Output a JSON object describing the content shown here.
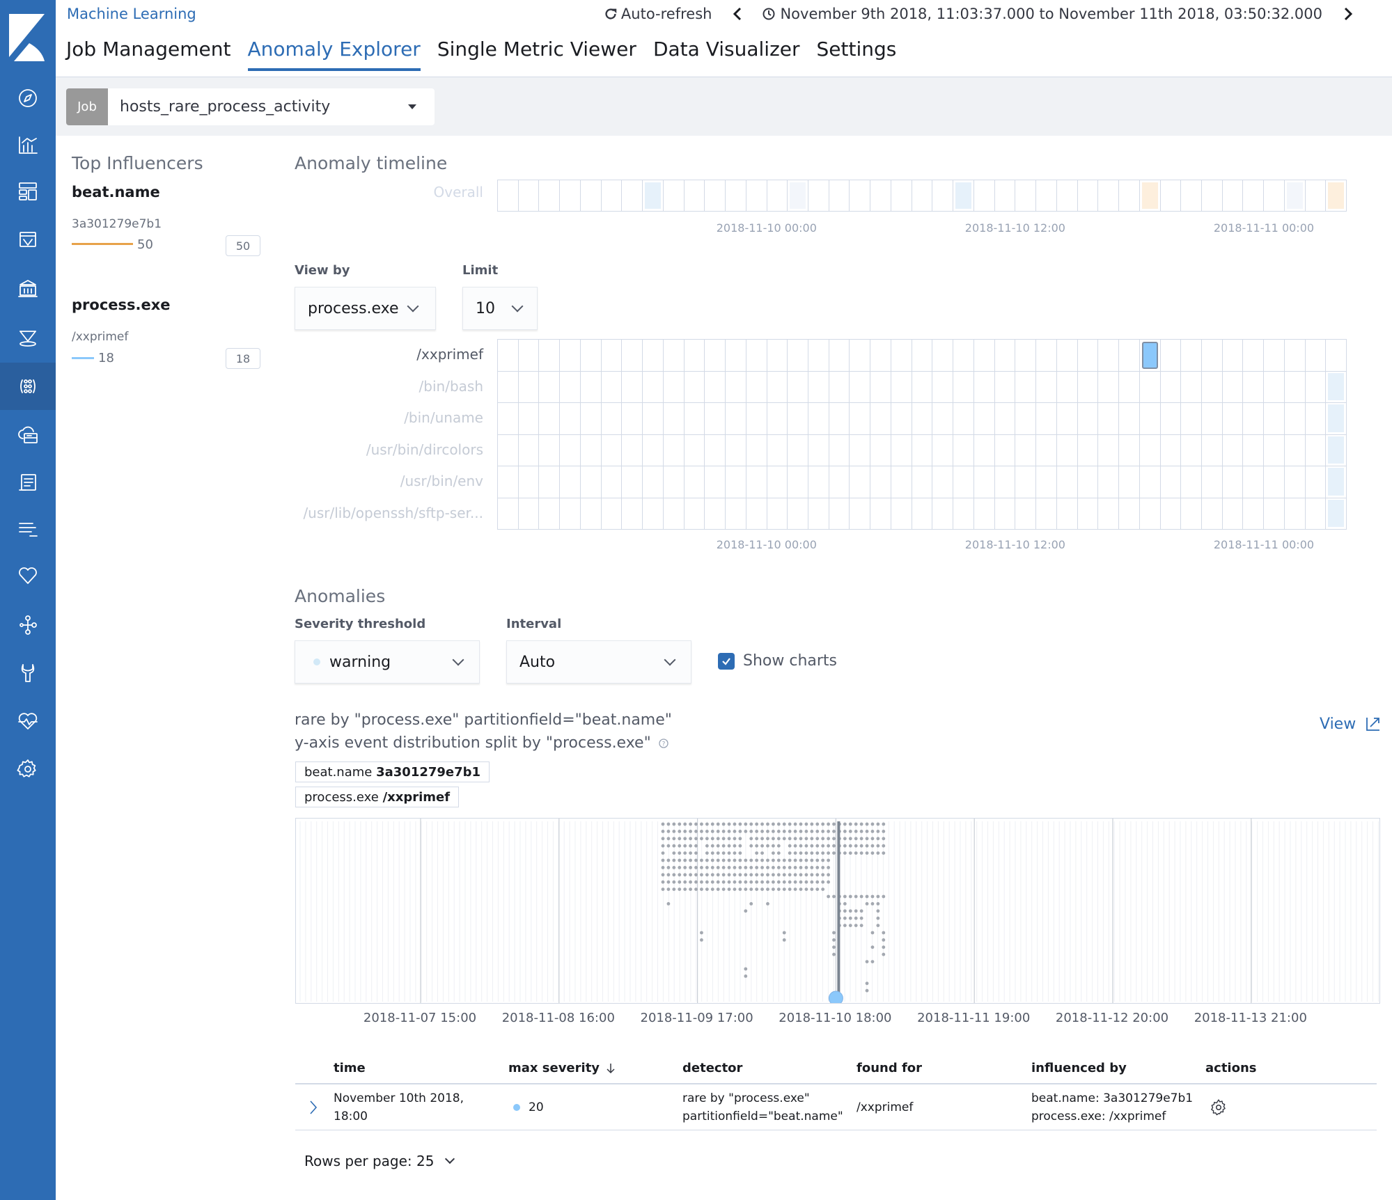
{
  "app": {
    "title": "Machine Learning",
    "auto_refresh_label": "Auto-refresh",
    "time_range": "November 9th 2018, 11:03:37.000 to November 11th 2018, 03:50:32.000"
  },
  "sidebar": {
    "items": [
      {
        "name": "discover",
        "icon": "compass-icon"
      },
      {
        "name": "visualize",
        "icon": "visualize-icon"
      },
      {
        "name": "dashboard",
        "icon": "dashboard-icon"
      },
      {
        "name": "canvas",
        "icon": "canvas-icon"
      },
      {
        "name": "maps",
        "icon": "maps-icon"
      },
      {
        "name": "infrastructure",
        "icon": "infrastructure-icon"
      },
      {
        "name": "machine-learning",
        "icon": "machine-learning-icon",
        "active": true
      },
      {
        "name": "logs",
        "icon": "logs-icon"
      },
      {
        "name": "apm",
        "icon": "apm-icon"
      },
      {
        "name": "uptime",
        "icon": "uptime-icon"
      },
      {
        "name": "siem",
        "icon": "heart-icon"
      },
      {
        "name": "graph",
        "icon": "graph-icon"
      },
      {
        "name": "dev-tools",
        "icon": "wrench-icon"
      },
      {
        "name": "monitoring",
        "icon": "heartbeat-icon"
      },
      {
        "name": "management",
        "icon": "gear-icon"
      }
    ]
  },
  "tabs": [
    {
      "label": "Job Management",
      "active": false
    },
    {
      "label": "Anomaly Explorer",
      "active": true
    },
    {
      "label": "Single Metric Viewer",
      "active": false
    },
    {
      "label": "Data Visualizer",
      "active": false
    },
    {
      "label": "Settings",
      "active": false
    }
  ],
  "job_selector": {
    "tag": "Job",
    "value": "hosts_rare_process_activity"
  },
  "influencers": {
    "title": "Top Influencers",
    "groups": [
      {
        "field": "beat.name",
        "items": [
          {
            "value": "3a301279e7b1",
            "score": "50",
            "badge": "50",
            "color": "#e7a24a"
          }
        ]
      },
      {
        "field": "process.exe",
        "items": [
          {
            "value": "/xxprimef",
            "score": "18",
            "badge": "18",
            "color": "#8bc8fb"
          }
        ]
      }
    ]
  },
  "timeline": {
    "title": "Anomaly timeline",
    "overall_label": "Overall",
    "num_buckets": 41,
    "overall_cells": [
      {
        "index": 7,
        "color": "#e6f1fa"
      },
      {
        "index": 14,
        "color": "#f3f6fb"
      },
      {
        "index": 22,
        "color": "#e6f1fa"
      },
      {
        "index": 31,
        "color": "#fdefdd"
      },
      {
        "index": 38,
        "color": "#f3f6fb"
      },
      {
        "index": 40,
        "color": "#fdefdd"
      }
    ],
    "axis_labels": [
      {
        "label": "2018-11-10 00:00",
        "bucket": 13
      },
      {
        "label": "2018-11-10 12:00",
        "bucket": 25
      },
      {
        "label": "2018-11-11 00:00",
        "bucket": 37
      }
    ],
    "view_by_label": "View by",
    "view_by_value": "process.exe",
    "limit_label": "Limit",
    "limit_value": "10",
    "lanes": [
      {
        "label": "/xxprimef",
        "active": true,
        "cells": [
          {
            "index": 31,
            "color": "#8bc8fb",
            "selected": true
          }
        ]
      },
      {
        "label": "/bin/bash",
        "active": false,
        "cells": [
          {
            "index": 40,
            "color": "#e6f1fa"
          }
        ]
      },
      {
        "label": "/bin/uname",
        "active": false,
        "cells": [
          {
            "index": 40,
            "color": "#e6f1fa"
          }
        ]
      },
      {
        "label": "/usr/bin/dircolors",
        "active": false,
        "cells": [
          {
            "index": 40,
            "color": "#e6f1fa"
          }
        ]
      },
      {
        "label": "/usr/bin/env",
        "active": false,
        "cells": [
          {
            "index": 40,
            "color": "#e6f1fa"
          }
        ]
      },
      {
        "label": "/usr/lib/openssh/sftp-ser...",
        "active": false,
        "cells": [
          {
            "index": 40,
            "color": "#e6f1fa"
          }
        ]
      }
    ]
  },
  "anomalies": {
    "title": "Anomalies",
    "severity_label": "Severity threshold",
    "severity_value": "warning",
    "severity_color": "#d2e9f7",
    "interval_label": "Interval",
    "interval_value": "Auto",
    "show_charts_label": "Show charts",
    "show_charts_checked": true
  },
  "chart_data": {
    "type": "scatter",
    "title": "rare by \"process.exe\" partitionfield=\"beat.name\"",
    "subtitle": "y-axis event distribution split by \"process.exe\"",
    "view_label": "View",
    "entities": [
      {
        "field": "beat.name",
        "value": "3a301279e7b1"
      },
      {
        "field": "process.exe",
        "value": "/xxprimef"
      }
    ],
    "x_tick_labels": [
      "2018-11-07 15:00",
      "2018-11-08 16:00",
      "2018-11-09 17:00",
      "2018-11-10 18:00",
      "2018-11-11 19:00",
      "2018-11-12 20:00",
      "2018-11-13 21:00"
    ],
    "anomaly_marker": {
      "time": "2018-11-10 18:00",
      "color": "#8bc8fb"
    },
    "description": "Event distribution: each row is a distinct process.exe value; dots mark hourly buckets where the process was seen. Dense activity 2018-11-09 ~14:00 through 2018-11-10 ~21:00; anomaly at 2018-11-10 18:00 for /xxprimef (bottom row)."
  },
  "table": {
    "columns": [
      "time",
      "max severity",
      "detector",
      "found for",
      "influenced by",
      "actions"
    ],
    "sort_column": "max severity",
    "rows": [
      {
        "time_line1": "November 10th 2018,",
        "time_line2": "18:00",
        "severity": "20",
        "severity_color": "#8bc8fb",
        "detector_line1": "rare by \"process.exe\"",
        "detector_line2": "partitionfield=\"beat.name\"",
        "found_for": "/xxprimef",
        "influenced_line1": "beat.name: 3a301279e7b1",
        "influenced_line2": "process.exe: /xxprimef"
      }
    ],
    "rows_per_page_label": "Rows per page: 25"
  }
}
